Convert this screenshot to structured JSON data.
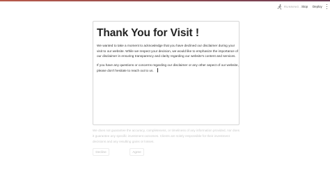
{
  "header": {
    "status_text": "RUNNING...",
    "status_icon": "running-figure-icon",
    "stop_label": "Stop",
    "deploy_label": "Deploy",
    "menu_icon": "kebab-menu-icon",
    "accent_gradient": [
      "#b85a4a",
      "#6a3b53"
    ]
  },
  "card": {
    "title": "Thank You for Visit !",
    "paragraph1": "We wanted to take a moment to acknowledge that you have declined our disclaimer during your visit to our website. While we respect your decision, we would like to emphasize the importance of our disclaimer in ensuring transparency and clarity regarding our website's content and services.",
    "paragraph2": "If you have any questions or concerns regarding our disclaimer or any other aspect of our website, please don't hesitate to reach out to us."
  },
  "disclaimer": {
    "text": "We does not guarantee the accuracy, completeness, or timeliness of any information provided, nor does it guarantee any specific investment outcomes. Clients are solely responsible for their investment decisions and any resulting gains or losses."
  },
  "actions": {
    "decline_label": "Decline",
    "agree_label": "Agree"
  }
}
